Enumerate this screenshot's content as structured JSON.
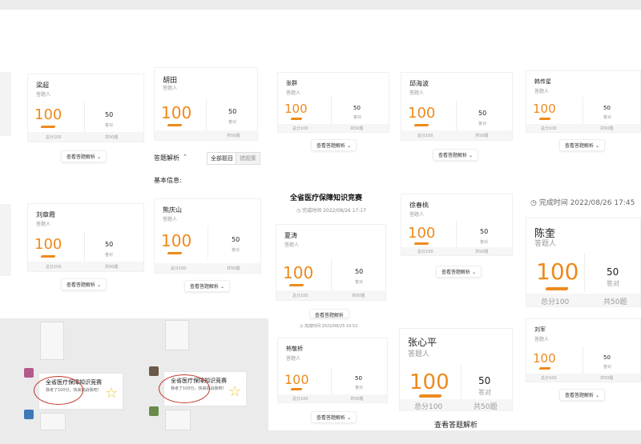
{
  "labels": {
    "role": "答题人",
    "answered": "答对",
    "view_analysis": "查看答题解析",
    "answer_analysis": "答题解析",
    "all_questions": "全部题目",
    "wrong_questions": "错题集",
    "basic_info": "基本信息:",
    "competition_title": "全省医疗保障知识竞赛",
    "time_prefix": "完成时间",
    "chat_text": "我考了100分，快来挑战我吧!"
  },
  "cards": [
    {
      "name": "梁超",
      "score": "100",
      "correct": "50",
      "total": "总分100",
      "count": "共50题"
    },
    {
      "name": "胡田",
      "score": "100",
      "correct": "50",
      "total": "",
      "count": "共50题"
    },
    {
      "name": "张群",
      "score": "100",
      "correct": "50",
      "total": "总分100",
      "count": "共50题"
    },
    {
      "name": "邱海波",
      "score": "100",
      "correct": "50",
      "total": "总分100",
      "count": "共50题"
    },
    {
      "name": "韩传星",
      "score": "100",
      "correct": "50",
      "total": "总分100",
      "count": "共50题"
    },
    {
      "name": "刘章霞",
      "score": "100",
      "correct": "50",
      "total": "总分100",
      "count": "共50题"
    },
    {
      "name": "熊庆山",
      "score": "100",
      "correct": "50",
      "total": "总分100",
      "count": "共50题"
    },
    {
      "name": "夏涛",
      "score": "100",
      "correct": "50",
      "total": "总分100",
      "count": "共50题"
    },
    {
      "name": "徐春桃",
      "score": "100",
      "correct": "50",
      "total": "总分100",
      "count": "共50题"
    },
    {
      "name": "陈奎",
      "score": "100",
      "correct": "50",
      "total": "总分100",
      "count": "共50题"
    },
    {
      "name": "熊敬桥",
      "score": "100",
      "correct": "50",
      "total": "总分100",
      "count": "共50题"
    },
    {
      "name": "张心平",
      "score": "100",
      "correct": "50",
      "total": "总分100",
      "count": "共50题"
    },
    {
      "name": "刘军",
      "score": "100",
      "correct": "50",
      "total": "总分100",
      "count": "共50题"
    }
  ],
  "times": {
    "t1": "2022/08/26 17:17",
    "t2": "2022/08/26 17:45",
    "t3": "2022/08/25 10:52"
  },
  "colors": {
    "accent": "#ee8a1b",
    "circle": "#c0392b",
    "star": "#f3c23a"
  }
}
